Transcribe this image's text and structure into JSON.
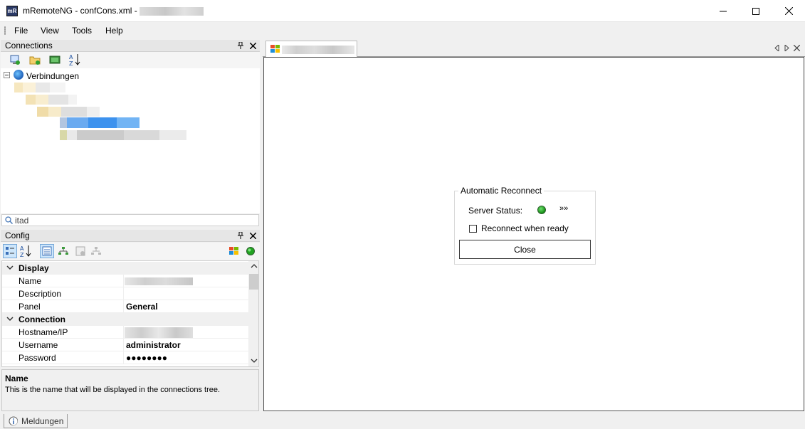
{
  "window": {
    "title": "mRemoteNG - confCons.xml - ",
    "icon_label": "mR"
  },
  "menu": {
    "items": [
      "File",
      "View",
      "Tools",
      "Help"
    ]
  },
  "connections_panel": {
    "title": "Connections",
    "toolbar_icons": [
      "new-connection-icon",
      "new-folder-icon",
      "view-icon",
      "sort-az-icon"
    ],
    "tree_root": "Verbindungen",
    "search_value": "itad"
  },
  "config_panel": {
    "title": "Config",
    "toolbar_icons": [
      "categorized-icon",
      "alphabetical-icon",
      "properties-icon",
      "inheritance-icon",
      "default-properties-icon",
      "default-inheritance-icon"
    ],
    "categories": [
      {
        "name": "Display",
        "rows": [
          {
            "label": "Name",
            "value": ""
          },
          {
            "label": "Description",
            "value": ""
          },
          {
            "label": "Panel",
            "value": "General"
          }
        ]
      },
      {
        "name": "Connection",
        "rows": [
          {
            "label": "Hostname/IP",
            "value": ""
          },
          {
            "label": "Username",
            "value": "administrator"
          },
          {
            "label": "Password",
            "value": "●●●●●●●●"
          }
        ]
      }
    ],
    "description_title": "Name",
    "description_text": "This is the name that will be displayed in the connections tree."
  },
  "reconnect": {
    "group_title": "Automatic Reconnect",
    "server_status_label": "Server Status:",
    "status_color": "#1a9b1a",
    "chevrons": "»»",
    "reconnect_when_ready_label": "Reconnect when ready",
    "reconnect_when_ready_checked": false,
    "close_label": "Close"
  },
  "bottom_dock": {
    "tab_label": "Meldungen"
  },
  "colors": {
    "accent_selected": "#3399ff",
    "panel_header": "#e6e6e6"
  }
}
